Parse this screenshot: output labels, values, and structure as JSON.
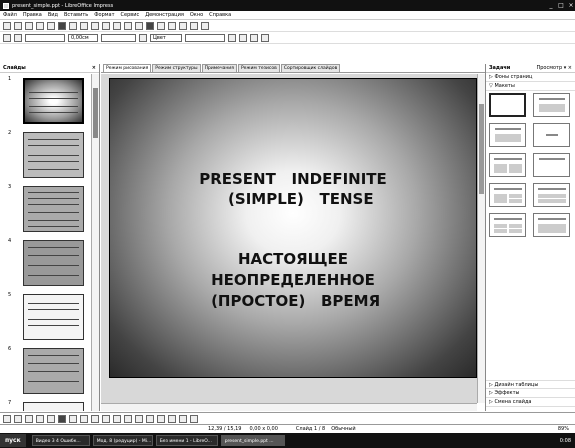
{
  "window": {
    "title": "present_simple.ppt - LibreOffice Impress",
    "controls": [
      "_",
      "□",
      "×"
    ]
  },
  "menu": [
    "Файл",
    "Правка",
    "Вид",
    "Вставить",
    "Формат",
    "Сервис",
    "Демонстрация",
    "Окно",
    "Справка"
  ],
  "toolbar2": {
    "line_width": "0,00см",
    "area_color": "Цвет"
  },
  "slides_panel": {
    "title": "Слайды",
    "close": "×",
    "numbers": [
      "1",
      "2",
      "3",
      "4",
      "5",
      "6",
      "7"
    ]
  },
  "view_tabs": [
    "Режим рисования",
    "Режим структуры",
    "Примечания",
    "Режим тезисов",
    "Сортировщик слайдов"
  ],
  "slide": {
    "title": "PRESENT   INDEFINITE\n   (SIMPLE)   TENSE",
    "body": "НАСТОЯЩЕЕ\nНЕОПРЕДЕЛЕННОЕ\n (ПРОСТОЕ)   ВРЕМЯ"
  },
  "tasks_panel": {
    "title": "Задачи",
    "view": "Просмотр ▾ ×",
    "sections": [
      "Фоны страниц",
      "Макеты"
    ],
    "bottom_sections": [
      "Дизайн таблицы",
      "Эффекты",
      "Смена слайда"
    ]
  },
  "status": {
    "position": "12,39 / 15,19",
    "size": "0,00 x 0,00",
    "slide": "Слайд 1 / 8",
    "style": "Обычный",
    "zoom": "89%"
  },
  "taskbar": {
    "start": "пуск",
    "tasks": [
      "Видео 3 4 Ошибк...",
      "Мод. 8 (редуцир) - Mi...",
      "Без имени 1 - LibreO...",
      "present_simple.ppt ..."
    ],
    "clock": "0:08"
  }
}
